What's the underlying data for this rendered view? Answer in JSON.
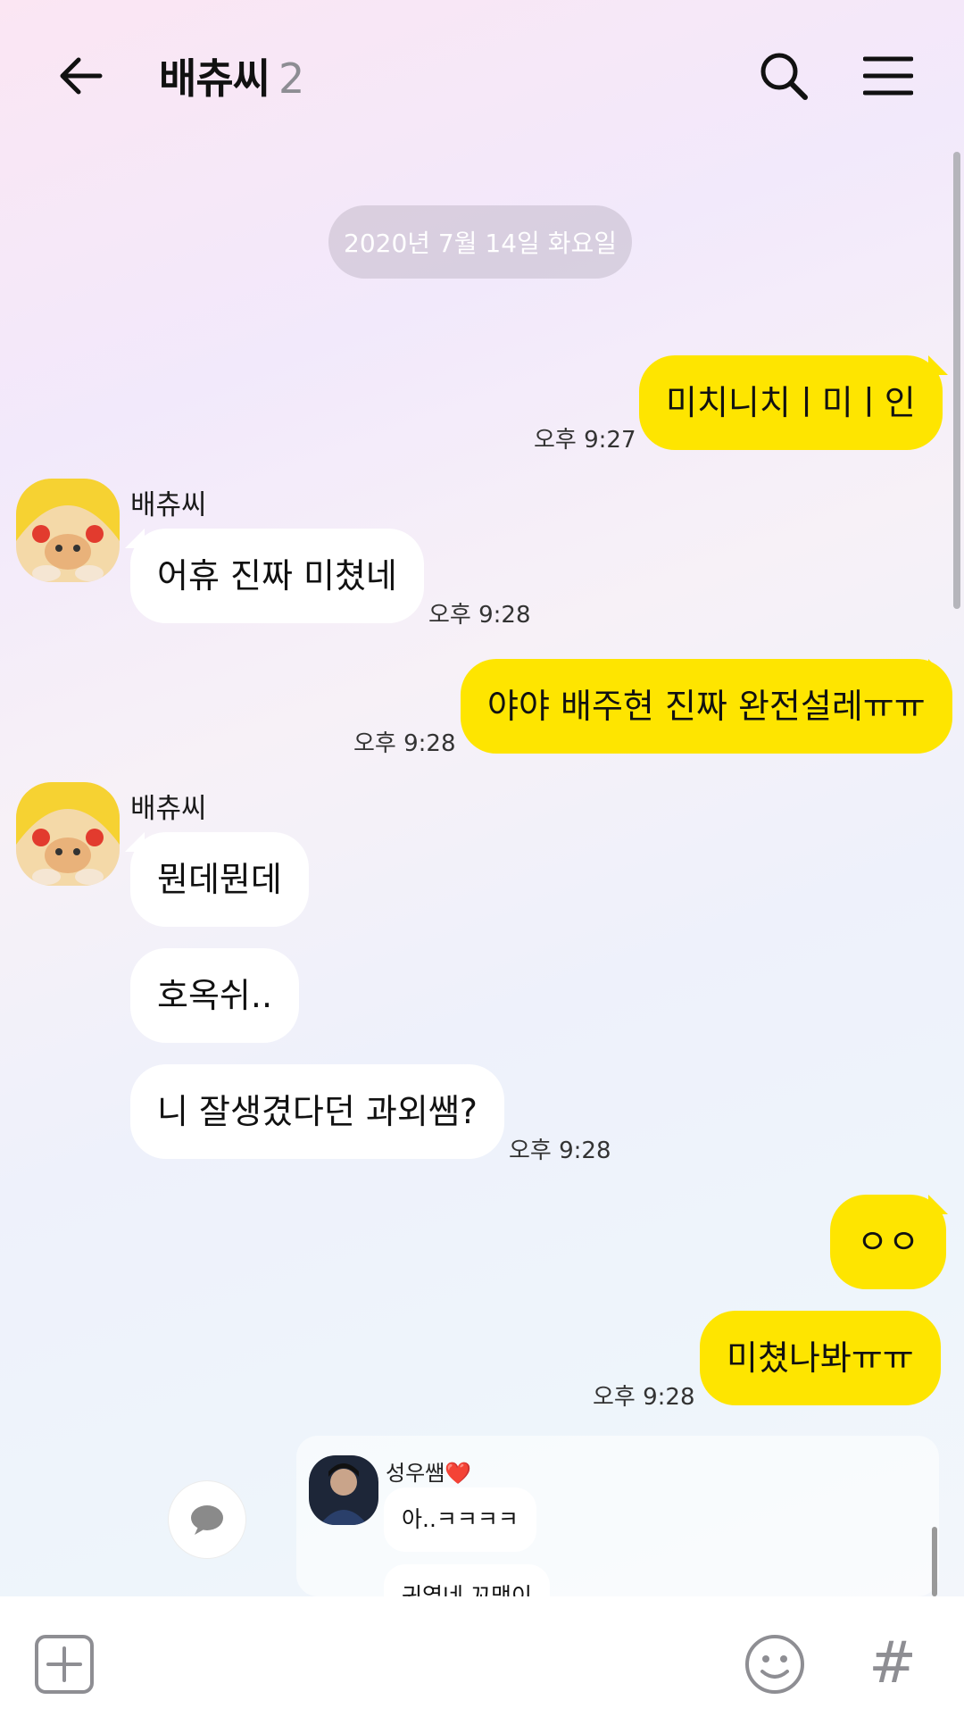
{
  "header": {
    "title": "배츄씨",
    "member_count": "2",
    "icons": [
      "back-arrow-icon",
      "search-icon",
      "menu-icon"
    ]
  },
  "date_divider": "2020년 7월 14일 화요일",
  "messages": [
    {
      "from": "me",
      "text": "미치니치ㅣ미ㅣ인",
      "time": "오후 9:27"
    },
    {
      "from": "배츄씨",
      "sender_label": "배츄씨",
      "text": "어휴 진짜 미쳤네",
      "time": "오후 9:28"
    },
    {
      "from": "me",
      "text": "야야 배주현 진짜 완전설레ㅠㅠ",
      "time": "오후 9:28"
    },
    {
      "from": "배츄씨",
      "sender_label": "배츄씨",
      "texts": [
        "뭔데뭔데",
        "호옥쉬..",
        "니 잘생겼다던 과외쌤?"
      ],
      "time": "오후 9:28"
    },
    {
      "from": "me",
      "texts": [
        "ㅇㅇ",
        "미쳤나봐ㅠㅠ"
      ],
      "time": "오후 9:28"
    }
  ],
  "shared_preview": {
    "name": "성우쌤❤️",
    "messages": [
      "아..ㅋㅋㅋㅋ",
      "귀엽네 꼬맹이"
    ]
  },
  "input_bar": {
    "icons": [
      "plus-icon",
      "emoji-icon",
      "hash-icon"
    ],
    "hash_symbol": "#"
  },
  "colors": {
    "my_bubble": "#fee500",
    "their_bubble": "#ffffff"
  }
}
